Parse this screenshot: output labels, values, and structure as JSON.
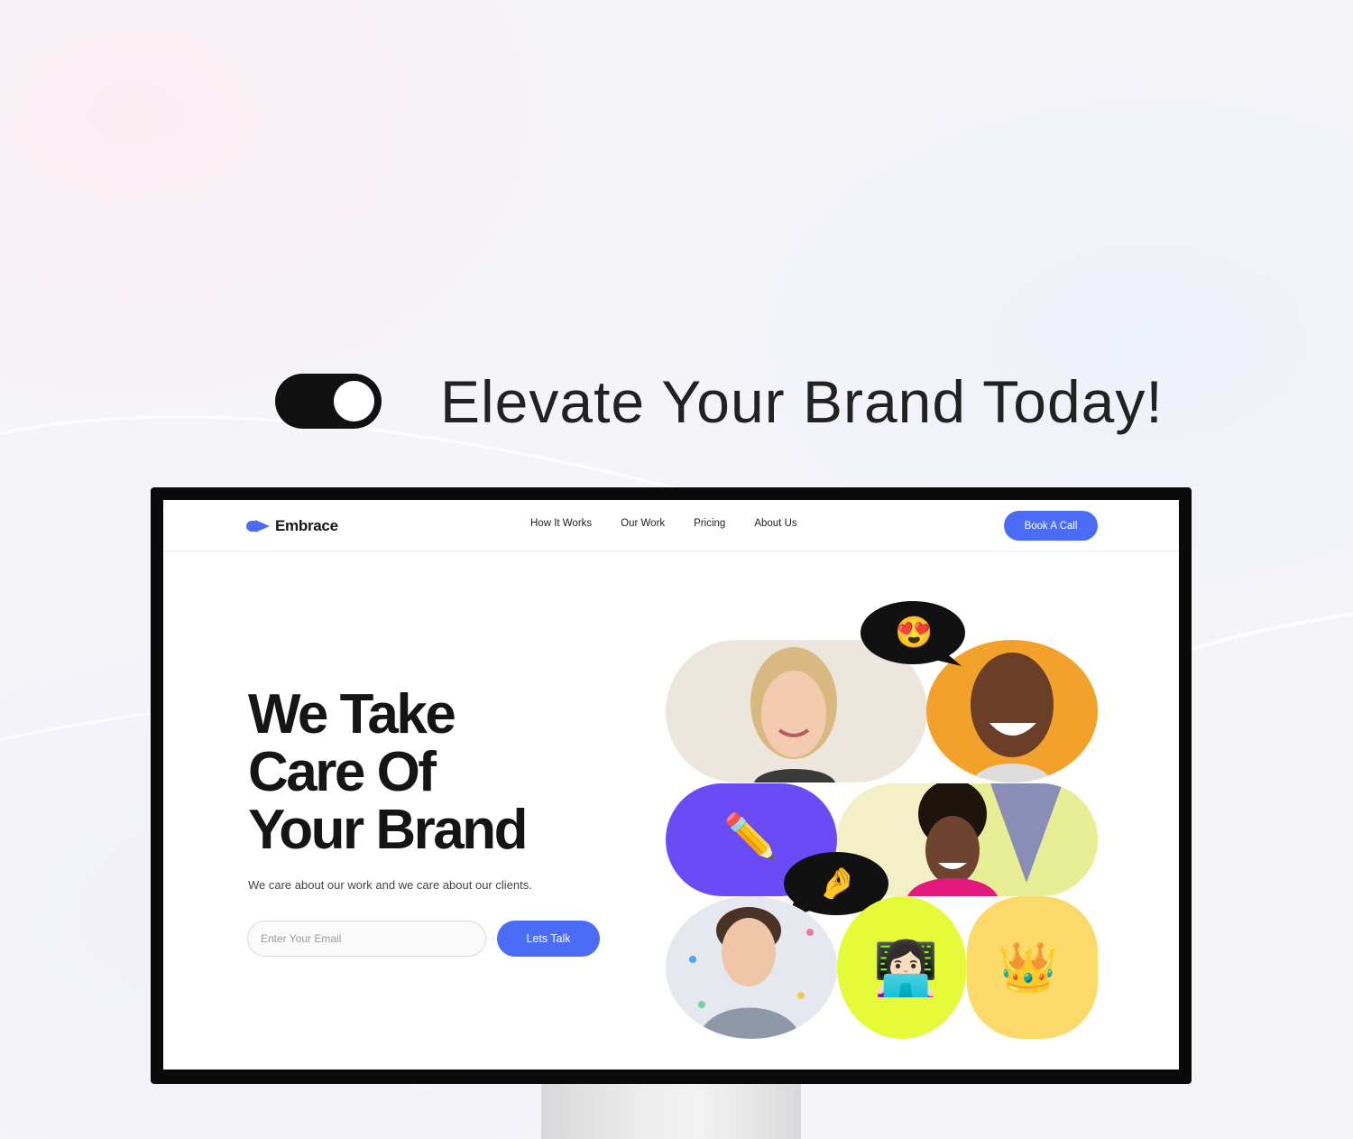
{
  "promo": {
    "headline": "Elevate Your Brand Today!"
  },
  "site": {
    "brand": "Embrace",
    "nav": [
      "How It Works",
      "Our Work",
      "Pricing",
      "About Us"
    ],
    "cta": "Book A Call",
    "hero": {
      "title_lines": [
        "We Take",
        "Care Of",
        "Your Brand"
      ],
      "subtitle": "We care about our work and we care about our clients.",
      "email_placeholder": "Enter Your Email",
      "submit_label": "Lets Talk"
    },
    "collage_emojis": {
      "heart_eyes": "😍",
      "pencil": "✏️",
      "pinched_fingers": "🤌",
      "woman_technologist": "👩🏻‍💻",
      "crown": "👑"
    }
  },
  "colors": {
    "accent": "#4a6cf7",
    "purple": "#6a4cf6",
    "lime": "#e5fb3a",
    "yellow": "#fbd96a",
    "orange": "#f2a12b",
    "dark": "#111111"
  }
}
